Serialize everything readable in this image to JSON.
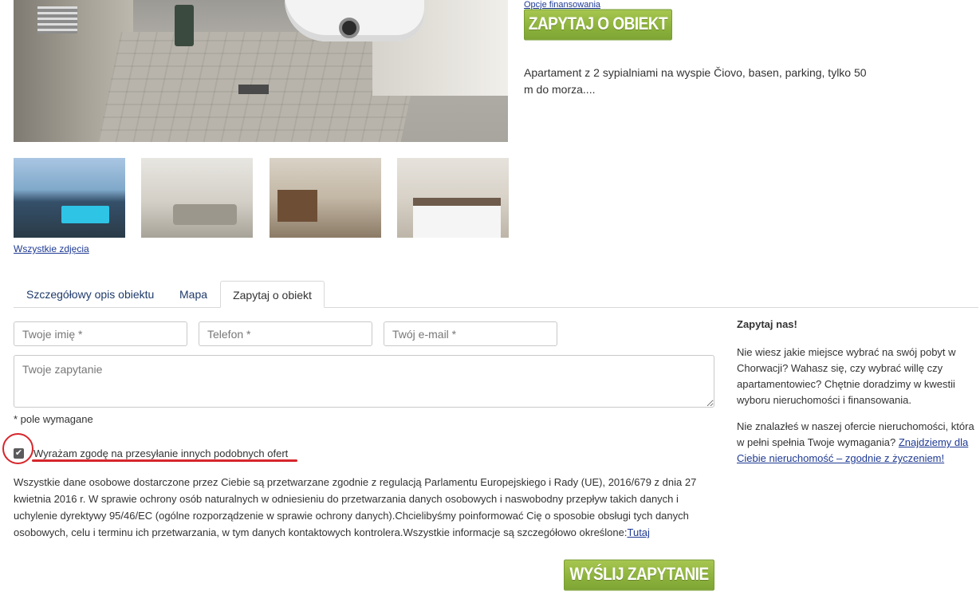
{
  "header": {
    "finance_link": "Opcje finansowania",
    "ask_button": "ZAPYTAJ O OBIEKT",
    "short_description": "Apartament z 2 sypialniami na wyspie Čiovo, basen, parking, tylko 50 m do morza...."
  },
  "gallery": {
    "all_photos_link": "Wszystkie zdjęcia"
  },
  "tabs": [
    {
      "label": "Szczegółowy opis obiektu"
    },
    {
      "label": "Mapa"
    },
    {
      "label": "Zapytaj o obiekt",
      "active": true
    }
  ],
  "form": {
    "name_placeholder": "Twoje imię *",
    "phone_placeholder": "Telefon *",
    "email_placeholder": "Twój e-mail *",
    "message_placeholder": "Twoje zapytanie",
    "required_note": "* pole wymagane",
    "consent_label": "Wyrażam zgodę na przesyłanie innych podobnych ofert",
    "consent_checked": true,
    "gdpr_text": "Wszystkie dane osobowe dostarczone przez Ciebie są przetwarzane zgodnie z regulacją Parlamentu Europejskiego i Rady (UE), 2016/679 z dnia 27 kwietnia 2016 r. W sprawie ochrony osób naturalnych w odniesieniu do przetwarzania danych osobowych i naswobodny przepływ takich danych i uchylenie dyrektywy 95/46/EC (ogólne rozporządzenie w sprawie ochrony danych).Chcielibyśmy poinformować Cię o sposobie obsługi tych danych osobowych, celu i terminu ich przetwarzania, w tym danych kontaktowych kontrolera.Wszystkie informacje są szczegółowo określone:",
    "gdpr_link": "Tutaj",
    "submit_button": "WYŚLIJ ZAPYTANIE"
  },
  "sidebar": {
    "title": "Zapytaj nas!",
    "paragraph1": "Nie wiesz jakie miejsce wybrać na swój pobyt w Chorwacji? Wahasz się, czy wybrać willę czy apartamentowiec? Chętnie doradzimy w kwestii wyboru nieruchomości i finansowania.",
    "paragraph2_text": "Nie znalazłeś w naszej ofercie nieruchomości, która w pełni spełnia Twoje wymagania?",
    "paragraph2_link": "Znajdziemy dla Ciebie nieruchomość – zgodnie z życzeniem!"
  },
  "colors": {
    "button_green": "#8cb13c",
    "link_blue": "#1f3a93",
    "annotation_red": "#d6262b"
  }
}
